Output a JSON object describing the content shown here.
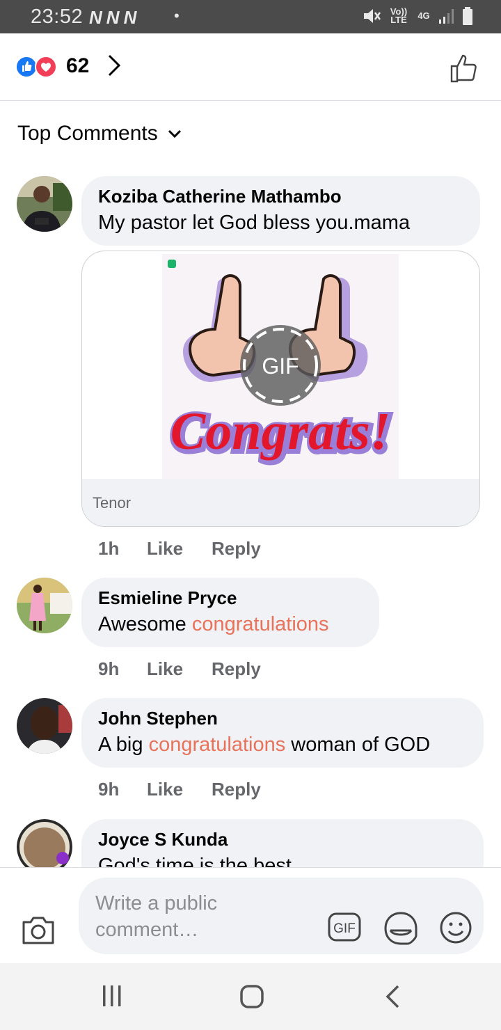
{
  "status_bar": {
    "time": "23:52",
    "notif_icons": [
      "N",
      "N",
      "N"
    ],
    "dot": "•",
    "network_label": "Vo)) LTE",
    "network_type": "4G"
  },
  "reactions": {
    "count": "62",
    "types": [
      "like",
      "love"
    ],
    "like_color": "#1877f2",
    "love_color": "#f33e58"
  },
  "sort": {
    "label": "Top Comments"
  },
  "comments": [
    {
      "name": "Koziba Catherine Mathambo",
      "text": "My pastor    let God bless you.mama",
      "gif": {
        "caption": "Congrats!",
        "badge": "GIF",
        "source": "Tenor"
      },
      "time": "1h",
      "like": "Like",
      "reply": "Reply"
    },
    {
      "name": "Esmieline Pryce",
      "text_before": "Awesome ",
      "text_highlight": "congratulations",
      "text_after": "",
      "time": "9h",
      "like": "Like",
      "reply": "Reply"
    },
    {
      "name": "John Stephen",
      "text_before": "A big ",
      "text_highlight": "congratulations",
      "text_after": " woman of GOD",
      "time": "9h",
      "like": "Like",
      "reply": "Reply"
    },
    {
      "name": "Joyce S Kunda",
      "text": "God's time is the best"
    }
  ],
  "composer": {
    "placeholder": "Write a public comment…",
    "gif_label": "GIF",
    "icons": [
      "camera-icon",
      "gif-icon",
      "sticker-icon",
      "emoji-icon"
    ]
  },
  "nav": {
    "icons": [
      "recents-icon",
      "home-icon",
      "back-icon"
    ]
  }
}
